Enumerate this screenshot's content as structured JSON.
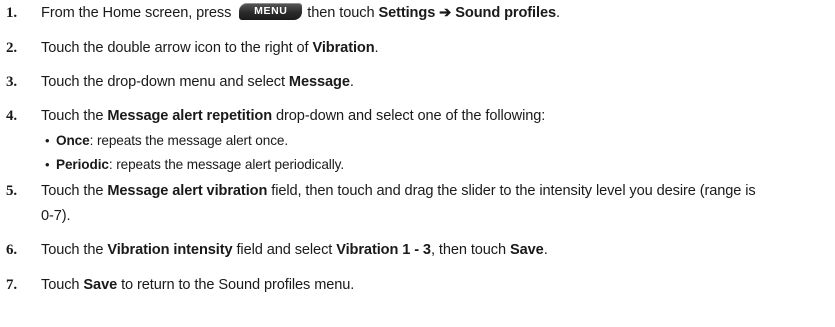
{
  "steps": [
    {
      "num": "1.",
      "pre": "From the Home screen, press",
      "key": "MENU",
      "mid": "then touch",
      "bold1": "Settings ➔ Sound profiles",
      "end": "."
    },
    {
      "num": "2.",
      "pre": "Touch the double arrow icon to the right of",
      "bold1": "Vibration",
      "end": "."
    },
    {
      "num": "3.",
      "pre": "Touch the drop-down menu and select",
      "bold1": "Message",
      "end": "."
    },
    {
      "num": "4.",
      "pre": "Touch the",
      "bold1": "Message alert repetition",
      "end": "drop-down and select one of the following:"
    },
    {
      "num": "5.",
      "pre": "Touch the",
      "bold1": "Message alert vibration",
      "end": "field, then touch and drag the slider to the intensity level you desire (range is",
      "cont": "0-7)."
    },
    {
      "num": "6.",
      "pre": "Touch the",
      "bold1": "Vibration intensity",
      "mid": "field and select",
      "bold2": "Vibration 1 - 3",
      "mid2": ", then touch",
      "bold3": "Save",
      "end": "."
    },
    {
      "num": "7.",
      "pre": "Touch",
      "bold1": "Save",
      "end": "to return to the Sound profiles menu."
    }
  ],
  "bullets": [
    {
      "term": "Once",
      "desc": ": repeats the message alert once."
    },
    {
      "term": "Periodic",
      "desc": ": repeats the message alert periodically."
    }
  ]
}
